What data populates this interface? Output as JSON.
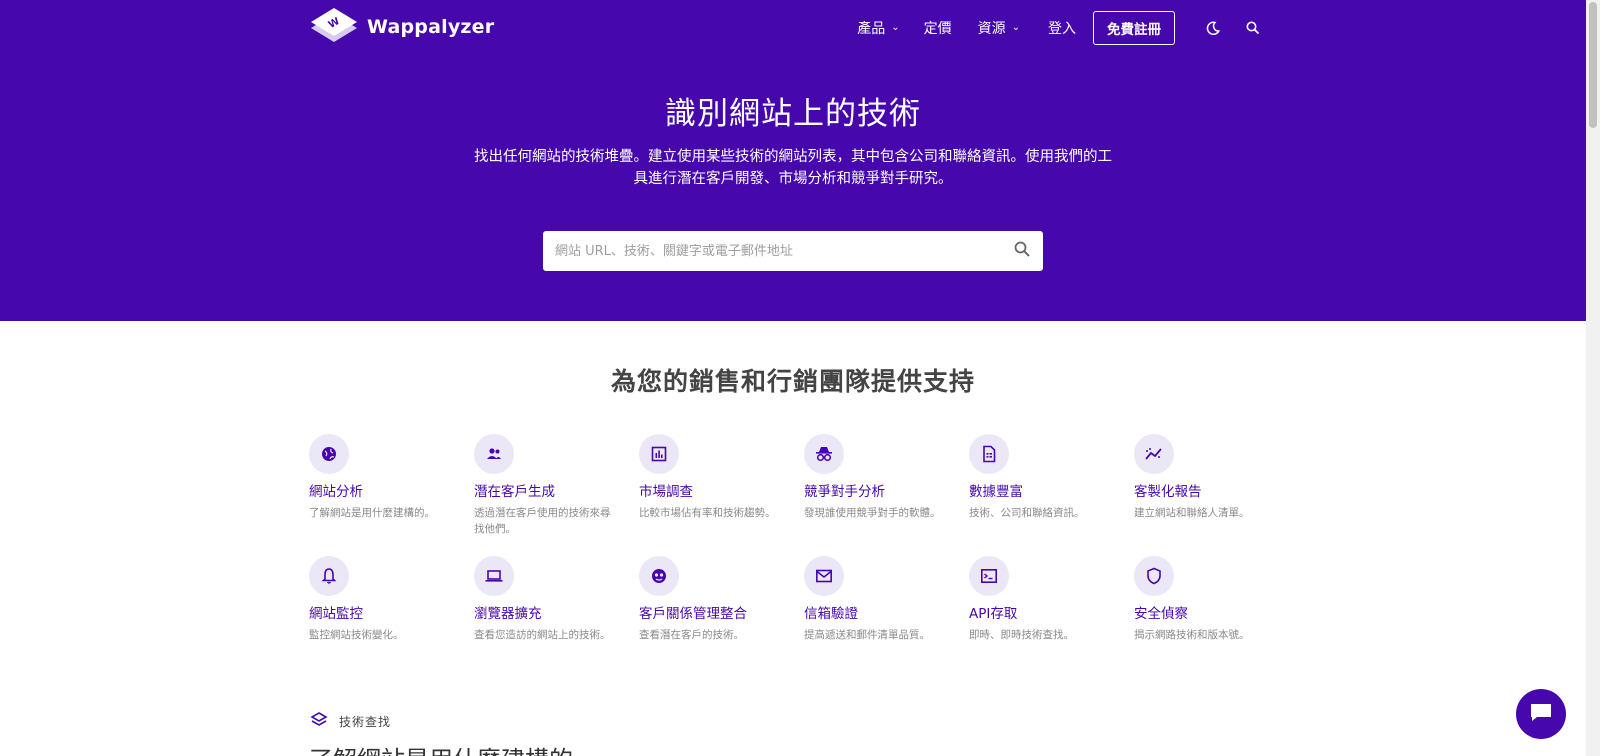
{
  "brand": {
    "name": "Wappalyzer",
    "color": "#4608ad"
  },
  "nav": {
    "items": [
      {
        "label": "產品",
        "has_dropdown": true
      },
      {
        "label": "定價",
        "has_dropdown": false
      },
      {
        "label": "資源",
        "has_dropdown": true
      },
      {
        "label": "登入",
        "has_dropdown": false
      }
    ],
    "signup_label": "免費註冊",
    "theme_icon": "moon-icon",
    "search_icon": "search-icon"
  },
  "hero": {
    "title": "識別網站上的技術",
    "subtitle": "找出任何網站的技術堆疊。建立使用某些技術的網站列表，其中包含公司和聯絡資訊。使用我們的工具進行潛在客戶開發、市場分析和競爭對手研究。",
    "search_placeholder": "網站 URL、技術、關鍵字或電子郵件地址"
  },
  "section": {
    "title": "為您的銷售和行銷團隊提供支持"
  },
  "features": [
    {
      "icon": "globe-icon",
      "title": "網站分析",
      "desc": "了解網站是用什麼建構的。"
    },
    {
      "icon": "people-icon",
      "title": "潛在客戶生成",
      "desc": "透過潛在客戶使用的技術來尋找他們。"
    },
    {
      "icon": "bar-chart-icon",
      "title": "市場調查",
      "desc": "比較市場佔有率和技術趨勢。"
    },
    {
      "icon": "spy-icon",
      "title": "競爭對手分析",
      "desc": "發現誰使用競爭對手的軟體。"
    },
    {
      "icon": "document-icon",
      "title": "數據豐富",
      "desc": "技術、公司和聯絡資訊。"
    },
    {
      "icon": "trend-icon",
      "title": "客製化報告",
      "desc": "建立網站和聯絡人清單。"
    },
    {
      "icon": "bell-icon",
      "title": "網站監控",
      "desc": "監控網站技術變化。"
    },
    {
      "icon": "laptop-icon",
      "title": "瀏覽器擴充",
      "desc": "查看您造訪的網站上的技術。"
    },
    {
      "icon": "face-icon",
      "title": "客戶關係管理整合",
      "desc": "查看潛在客戶的技術。"
    },
    {
      "icon": "mail-icon",
      "title": "信箱驗證",
      "desc": "提高遞送和郵件清單品質。"
    },
    {
      "icon": "terminal-icon",
      "title": "API存取",
      "desc": "即時、即時技術查找。"
    },
    {
      "icon": "shield-icon",
      "title": "安全偵察",
      "desc": "揭示網路技術和版本號。"
    }
  ],
  "tech_lookup": {
    "label": "技術查找",
    "icon": "layers-icon",
    "heading": "了解網站是用什麼建構的"
  },
  "chat": {
    "icon": "chat-icon"
  }
}
